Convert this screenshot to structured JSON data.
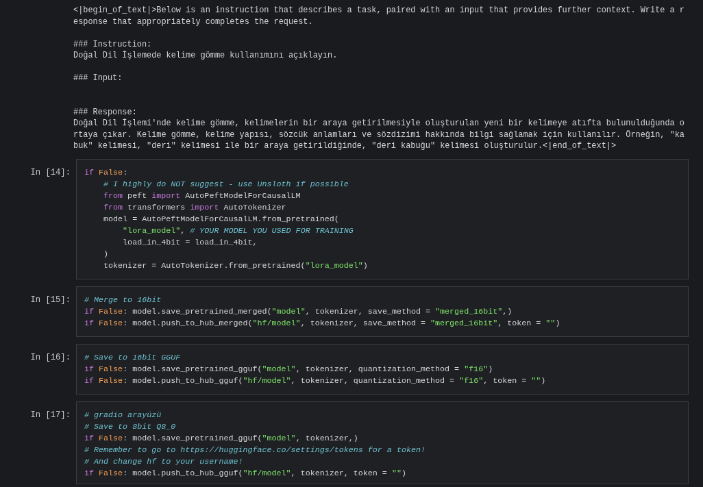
{
  "output": {
    "lines": [
      {
        "kind": "text",
        "text": "<|begin_of_text|>Below is an instruction that describes a task, paired with an input that provides further context. Write a r"
      },
      {
        "kind": "text",
        "text": "esponse that appropriately completes the request."
      },
      {
        "kind": "blank"
      },
      {
        "kind": "text",
        "text": "### Instruction:"
      },
      {
        "kind": "text",
        "text": "Doğal Dil İşlemede kelime gömme kullanımını açıklayın."
      },
      {
        "kind": "blank"
      },
      {
        "kind": "text",
        "text": "### Input:"
      },
      {
        "kind": "blank"
      },
      {
        "kind": "blank"
      },
      {
        "kind": "text",
        "text": "### Response:"
      },
      {
        "kind": "text",
        "text": "Doğal Dil İşlemi'nde kelime gömme, kelimelerin bir araya getirilmesiyle oluşturulan yeni bir kelimeye atıfta bulunulduğunda o"
      },
      {
        "kind": "text",
        "text": "rtaya çıkar. Kelime gömme, kelime yapısı, sözcük anlamları ve sözdizimi hakkında bilgi sağlamak için kullanılır. Örneğin, \"ka"
      },
      {
        "kind": "text",
        "text": "buk\" kelimesi, \"deri\" kelimesi ile bir araya getirildiğinde, \"deri kabuğu\" kelimesi oluşturulur.<|end_of_text|>"
      }
    ]
  },
  "cells": [
    {
      "prompt": "In [14]:",
      "lines": [
        [
          {
            "kind": "keyword",
            "text": "if"
          },
          {
            "kind": "constant",
            "text": " False"
          },
          {
            "kind": "plain",
            "text": ":"
          }
        ],
        [
          {
            "kind": "comment",
            "text": "    # I highly do NOT suggest - use Unsloth if possible"
          }
        ],
        [
          {
            "kind": "keyword",
            "text": "    from"
          },
          {
            "kind": "plain",
            "text": " peft "
          },
          {
            "kind": "keyword",
            "text": "import"
          },
          {
            "kind": "plain",
            "text": " AutoPeftModelForCausalLM"
          }
        ],
        [
          {
            "kind": "keyword",
            "text": "    from"
          },
          {
            "kind": "plain",
            "text": " transformers "
          },
          {
            "kind": "keyword",
            "text": "import"
          },
          {
            "kind": "plain",
            "text": " AutoTokenizer"
          }
        ],
        [
          {
            "kind": "plain",
            "text": "    model = AutoPeftModelForCausalLM.from_pretrained("
          }
        ],
        [
          {
            "kind": "string",
            "text": "        \"lora_model\""
          },
          {
            "kind": "plain",
            "text": ", "
          },
          {
            "kind": "comment",
            "text": "# YOUR MODEL YOU USED FOR TRAINING"
          }
        ],
        [
          {
            "kind": "plain",
            "text": "        load_in_4bit = load_in_4bit,"
          }
        ],
        [
          {
            "kind": "plain",
            "text": "    )"
          }
        ],
        [
          {
            "kind": "plain",
            "text": "    tokenizer = AutoTokenizer.from_pretrained("
          },
          {
            "kind": "string",
            "text": "\"lora_model\""
          },
          {
            "kind": "plain",
            "text": ")"
          }
        ]
      ]
    },
    {
      "prompt": "In [15]:",
      "lines": [
        [
          {
            "kind": "comment",
            "text": "# Merge to 16bit"
          }
        ],
        [
          {
            "kind": "keyword",
            "text": "if"
          },
          {
            "kind": "constant",
            "text": " False"
          },
          {
            "kind": "plain",
            "text": ": model.save_pretrained_merged("
          },
          {
            "kind": "string",
            "text": "\"model\""
          },
          {
            "kind": "plain",
            "text": ", tokenizer, save_method = "
          },
          {
            "kind": "string",
            "text": "\"merged_16bit\""
          },
          {
            "kind": "plain",
            "text": ",)"
          }
        ],
        [
          {
            "kind": "keyword",
            "text": "if"
          },
          {
            "kind": "constant",
            "text": " False"
          },
          {
            "kind": "plain",
            "text": ": model.push_to_hub_merged("
          },
          {
            "kind": "string",
            "text": "\"hf/model\""
          },
          {
            "kind": "plain",
            "text": ", tokenizer, save_method = "
          },
          {
            "kind": "string",
            "text": "\"merged_16bit\""
          },
          {
            "kind": "plain",
            "text": ", token = "
          },
          {
            "kind": "string",
            "text": "\"\""
          },
          {
            "kind": "plain",
            "text": ")"
          }
        ]
      ]
    },
    {
      "prompt": "In [16]:",
      "lines": [
        [
          {
            "kind": "comment",
            "text": "# Save to 16bit GGUF"
          }
        ],
        [
          {
            "kind": "keyword",
            "text": "if"
          },
          {
            "kind": "constant",
            "text": " False"
          },
          {
            "kind": "plain",
            "text": ": model.save_pretrained_gguf("
          },
          {
            "kind": "string",
            "text": "\"model\""
          },
          {
            "kind": "plain",
            "text": ", tokenizer, quantization_method = "
          },
          {
            "kind": "string",
            "text": "\"f16\""
          },
          {
            "kind": "plain",
            "text": ")"
          }
        ],
        [
          {
            "kind": "keyword",
            "text": "if"
          },
          {
            "kind": "constant",
            "text": " False"
          },
          {
            "kind": "plain",
            "text": ": model.push_to_hub_gguf("
          },
          {
            "kind": "string",
            "text": "\"hf/model\""
          },
          {
            "kind": "plain",
            "text": ", tokenizer, quantization_method = "
          },
          {
            "kind": "string",
            "text": "\"f16\""
          },
          {
            "kind": "plain",
            "text": ", token = "
          },
          {
            "kind": "string",
            "text": "\"\""
          },
          {
            "kind": "plain",
            "text": ")"
          }
        ]
      ]
    },
    {
      "prompt": "In [17]:",
      "lines": [
        [
          {
            "kind": "comment",
            "text": "# gradio arayüzü"
          }
        ],
        [
          {
            "kind": "comment",
            "text": "# Save to 8bit Q8_0"
          }
        ],
        [
          {
            "kind": "keyword",
            "text": "if"
          },
          {
            "kind": "constant",
            "text": " False"
          },
          {
            "kind": "plain",
            "text": ": model.save_pretrained_gguf("
          },
          {
            "kind": "string",
            "text": "\"model\""
          },
          {
            "kind": "plain",
            "text": ", tokenizer,)"
          }
        ],
        [
          {
            "kind": "comment",
            "text": "# Remember to go to https://huggingface.co/settings/tokens for a token!"
          }
        ],
        [
          {
            "kind": "comment",
            "text": "# And change hf to your username!"
          }
        ],
        [
          {
            "kind": "keyword",
            "text": "if"
          },
          {
            "kind": "constant",
            "text": " False"
          },
          {
            "kind": "plain",
            "text": ": model.push_to_hub_gguf("
          },
          {
            "kind": "string",
            "text": "\"hf/model\""
          },
          {
            "kind": "plain",
            "text": ", tokenizer, token = "
          },
          {
            "kind": "string",
            "text": "\"\""
          },
          {
            "kind": "plain",
            "text": ")"
          }
        ]
      ]
    }
  ]
}
